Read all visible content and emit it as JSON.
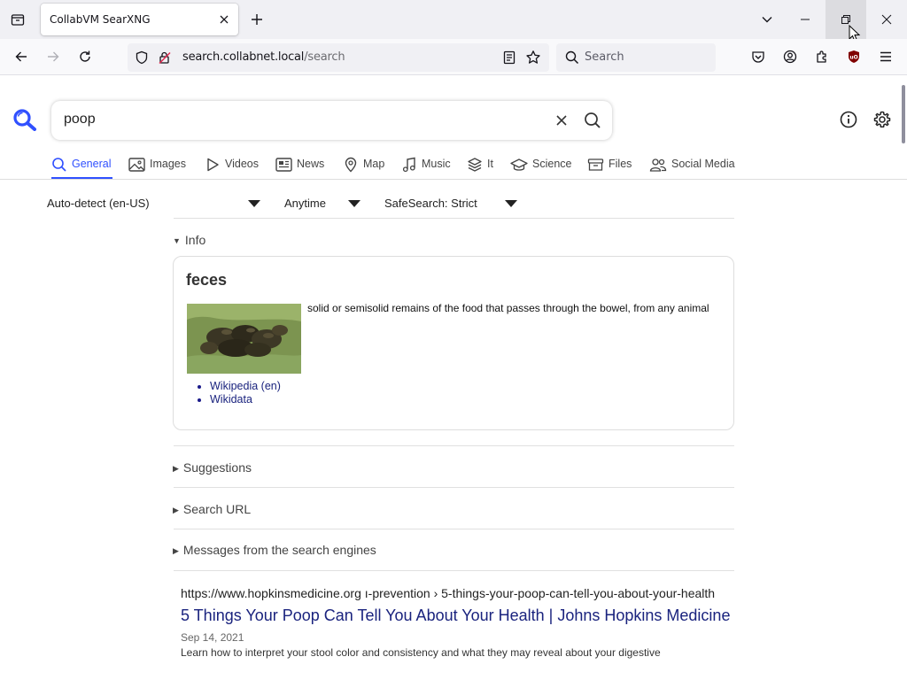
{
  "browser": {
    "tab_title": "CollabVM SearXNG",
    "url_host": "search.collabnet.local",
    "url_path": "/search",
    "search_placeholder": "Search"
  },
  "search": {
    "query": "poop"
  },
  "categories": [
    {
      "label": "General",
      "icon": "search-icon",
      "active": true
    },
    {
      "label": "Images",
      "icon": "image-icon"
    },
    {
      "label": "Videos",
      "icon": "play-icon"
    },
    {
      "label": "News",
      "icon": "newspaper-icon"
    },
    {
      "label": "Map",
      "icon": "map-pin-icon"
    },
    {
      "label": "Music",
      "icon": "music-icon"
    },
    {
      "label": "It",
      "icon": "layers-icon"
    },
    {
      "label": "Science",
      "icon": "school-icon"
    },
    {
      "label": "Files",
      "icon": "archive-icon"
    },
    {
      "label": "Social Media",
      "icon": "people-icon"
    }
  ],
  "filters": {
    "language": "Auto-detect (en-US)",
    "time_range": "Anytime",
    "safesearch": "SafeSearch: Strict"
  },
  "sections": {
    "info": "Info",
    "suggestions": "Suggestions",
    "search_url": "Search URL",
    "engine_messages": "Messages from the search engines"
  },
  "infobox": {
    "title": "feces",
    "description": "solid or semisolid remains of the food that passes through the bowel, from any animal",
    "links": [
      "Wikipedia (en)",
      "Wikidata"
    ]
  },
  "results": [
    {
      "url": "https://www.hopkinsmedicine.org  ı-prevention › 5-things-your-poop-can-tell-you-about-your-health",
      "title": "5 Things Your Poop Can Tell You About Your Health | Johns Hopkins Medicine",
      "date": "Sep 14, 2021",
      "snippet": "Learn how to interpret your stool color and consistency and what they may reveal about your digestive"
    }
  ],
  "colors": {
    "accent": "#3050ff",
    "link": "#1a237e",
    "ublock": "#800000"
  }
}
